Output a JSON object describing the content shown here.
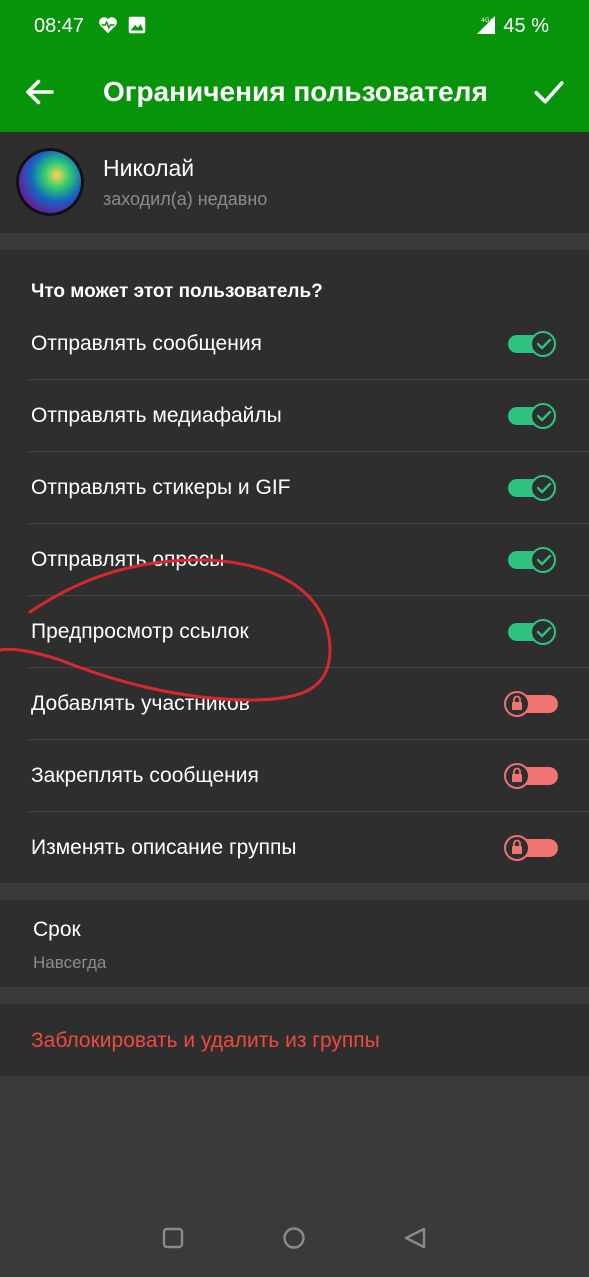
{
  "status_bar": {
    "time": "08:47",
    "network": "4G+",
    "battery": "45 %",
    "icons": [
      "heart-pulse-icon",
      "image-icon",
      "signal-icon"
    ]
  },
  "toolbar": {
    "title": "Ограничения пользователя",
    "back_icon": "arrow-left-icon",
    "confirm_icon": "checkmark-icon",
    "accent_color": "#08940a"
  },
  "user": {
    "name": "Николай",
    "status": "заходил(а) недавно"
  },
  "permissions": {
    "header": "Что может этот пользователь?",
    "items": [
      {
        "label": "Отправлять сообщения",
        "enabled": true
      },
      {
        "label": "Отправлять медиафайлы",
        "enabled": true
      },
      {
        "label": "Отправлять стикеры и GIF",
        "enabled": true
      },
      {
        "label": "Отправлять опросы",
        "enabled": true
      },
      {
        "label": "Предпросмотр ссылок",
        "enabled": true
      },
      {
        "label": "Добавлять участников",
        "enabled": false,
        "locked": true
      },
      {
        "label": "Закреплять сообщения",
        "enabled": false,
        "locked": true
      },
      {
        "label": "Изменять описание группы",
        "enabled": false,
        "locked": true
      }
    ],
    "on_color": "#2ec27e",
    "off_color": "#f07373"
  },
  "term": {
    "title": "Срок",
    "value": "Навсегда"
  },
  "ban": {
    "label": "Заблокировать и удалить из группы",
    "color": "#ee4a3e"
  },
  "navigation": {
    "buttons": [
      "recents-square-icon",
      "home-circle-icon",
      "back-triangle-icon"
    ]
  }
}
